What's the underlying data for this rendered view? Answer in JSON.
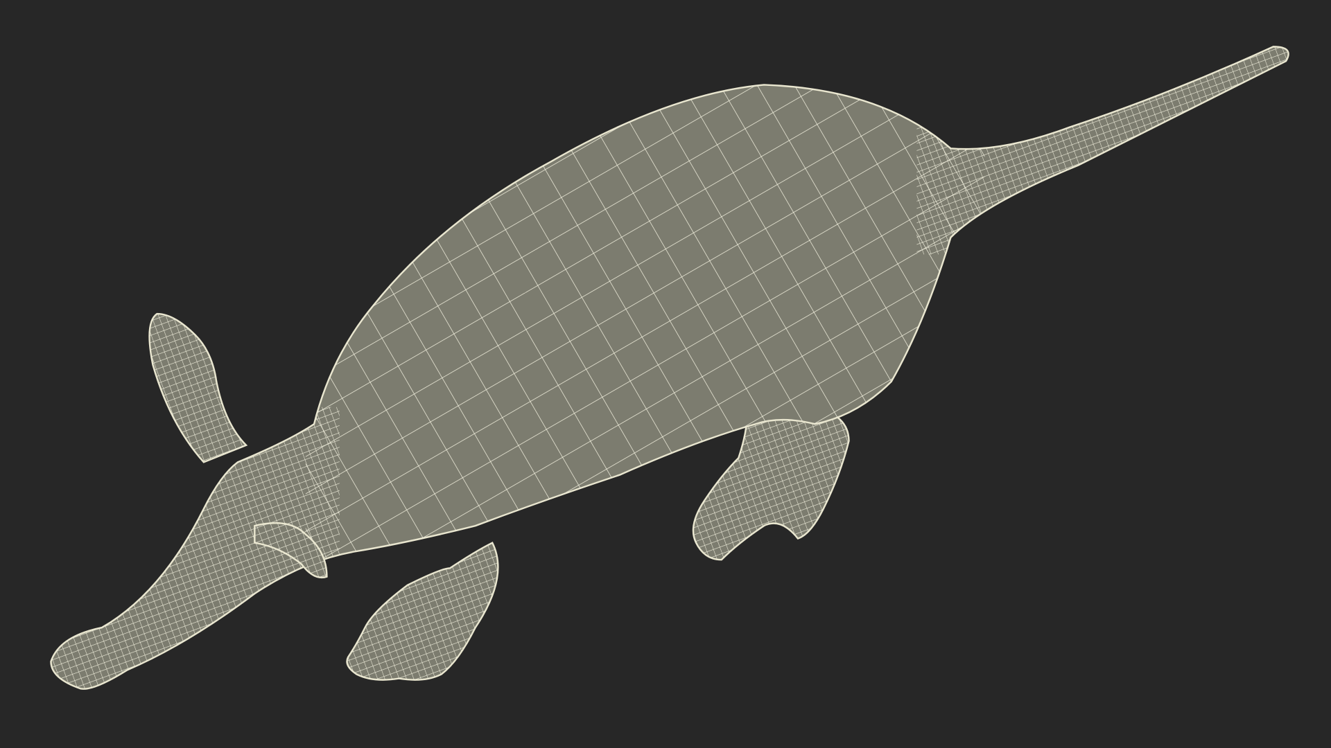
{
  "scene": {
    "subject": "aardvark-wireframe-model",
    "colors": {
      "background": "#272727",
      "surface": "#7c7c6f",
      "wireframe": "#f3f1df",
      "outline": "#e9e6cf"
    }
  }
}
